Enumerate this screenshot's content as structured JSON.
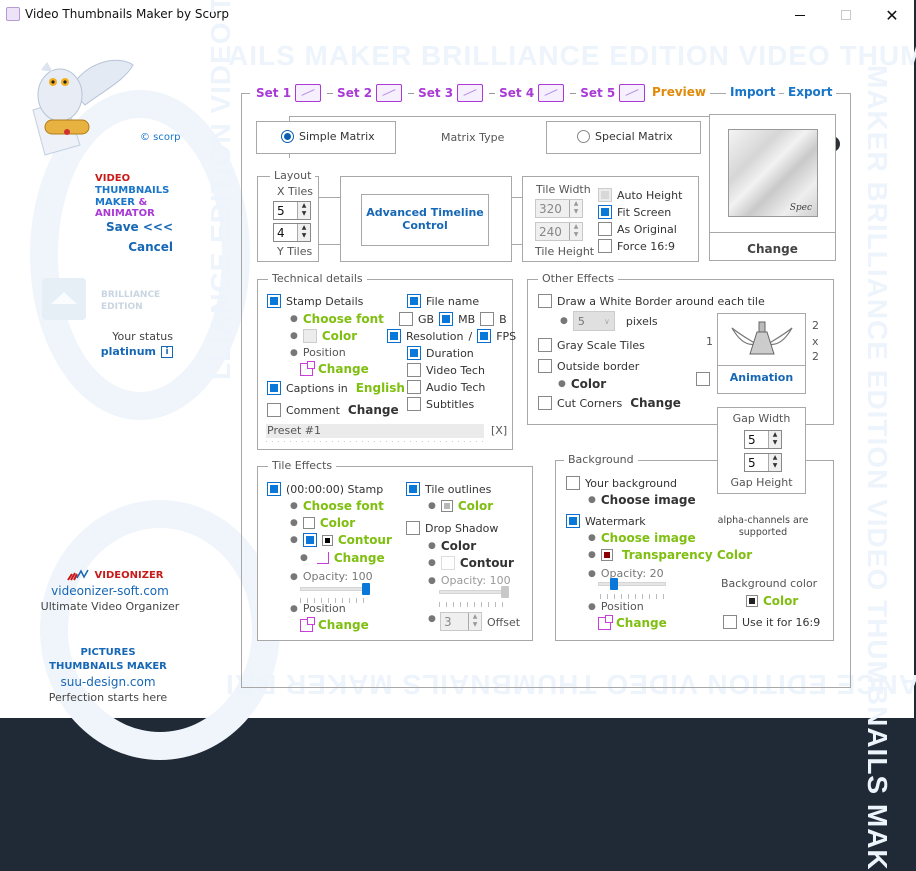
{
  "window": {
    "title": "Video Thumbnails Maker by Scorp",
    "minimize": "minimize",
    "maximize": "maximize",
    "close": "✕"
  },
  "watermark": {
    "top": "AILS MAKER BRILLIANCE EDITION VIDEO THUMBNAILS M",
    "bottom": "ER BRILLIANCE EDITION VIDEO THUMBNAILS MAKER BRI",
    "left": "LLIANCE EDITION VIDEO THUMBNAIL VIDEO THUMBN",
    "right": "MAKER BRILLIANCE EDITION VIDEO THUMBNAILS MAK"
  },
  "sidebar": {
    "copyright": "© scorp",
    "brand_line1": "VIDEO",
    "brand_line2": "THUMBNAILS",
    "brand_line3a": "MAKER",
    "brand_line3b": "& ANIMATOR",
    "save": "Save <<<",
    "cancel": "Cancel",
    "edition_line1": "BRILLIANCE",
    "edition_line2": "EDITION",
    "status_label": "Your status",
    "status_value": "platinum",
    "info": "i",
    "videonizer": {
      "name": "VIDEONIZER",
      "url": "videonizer-soft.com",
      "tagline": "Ultimate Video Organizer"
    },
    "pictures": {
      "line1": "PICTURES",
      "line2": "THUMBNAILS MAKER",
      "url": "suu-design.com",
      "tagline": "Perfection starts here"
    }
  },
  "nav": {
    "sets": [
      "Set 1",
      "Set 2",
      "Set 3",
      "Set 4",
      "Set 5"
    ],
    "preview": "Preview",
    "import": "Import",
    "export": "Export",
    "next": "➜"
  },
  "matrix": {
    "simple": "Simple Matrix",
    "type_label": "Matrix Type",
    "special": "Special Matrix",
    "selected": "Simple Matrix",
    "preview_caption": "Spec",
    "change": "Change"
  },
  "layout": {
    "legend": "Layout",
    "x_label": "X Tiles",
    "x_value": "5",
    "y_value": "4",
    "y_label": "Y Tiles",
    "timeline_line1": "Advanced Timeline",
    "timeline_line2": "Control",
    "tile_width_label": "Tile Width",
    "tile_width": "320",
    "tile_height": "240",
    "tile_height_label": "Tile Height",
    "options": [
      {
        "label": "Auto Height",
        "checked": false,
        "disabled": true
      },
      {
        "label": "Fit Screen",
        "checked": true
      },
      {
        "label": "As Original",
        "checked": false
      },
      {
        "label": "Force 16:9",
        "checked": false
      }
    ]
  },
  "technical": {
    "legend": "Technical  details",
    "stamp_details": "Stamp Details",
    "choose_font": "Choose font",
    "color": "Color",
    "position": "Position",
    "change": "Change",
    "captions_in": "Captions in",
    "language": "English",
    "comment": "Comment",
    "comment_change": "Change",
    "file_name": "File name",
    "gb": "GB",
    "mb": "MB",
    "b": "B",
    "resolution": "Resolution",
    "slash": "/",
    "fps": "FPS",
    "duration": "Duration",
    "video_tech": "Video Tech",
    "audio_tech": "Audio Tech",
    "subtitles": "Subtitles",
    "preset": "Preset #1",
    "preset_close": "[X]"
  },
  "other_effects": {
    "legend": "Other Effects",
    "white_border": "Draw a White Border around each tile",
    "border_px": "5",
    "pixels": "pixels",
    "gray_scale": "Gray Scale Tiles",
    "outside_border": "Outside border",
    "color": "Color",
    "cut_corners": "Cut Corners",
    "change": "Change",
    "anim_left": "1",
    "anim_right_1": "2",
    "anim_right_x": "x",
    "anim_right_2": "2",
    "animation": "Animation"
  },
  "gap": {
    "width_label": "Gap Width",
    "width": "5",
    "height": "5",
    "height_label": "Gap Height"
  },
  "tile_effects": {
    "legend": "Tile Effects",
    "stamp": "(00:00:00) Stamp",
    "choose_font": "Choose font",
    "color": "Color",
    "contour": "Contour",
    "change": "Change",
    "opacity_label": "Opacity: 100",
    "opacity": 100,
    "position": "Position",
    "position_change": "Change",
    "tile_outlines": "Tile outlines",
    "outline_color": "Color",
    "drop_shadow": "Drop Shadow",
    "shadow_color": "Color",
    "shadow_contour": "Contour",
    "shadow_opacity_label": "Opacity: 100",
    "shadow_opacity": 100,
    "offset_value": "3",
    "offset": "Offset"
  },
  "background": {
    "legend": "Background",
    "your_background": "Your background",
    "choose_image": "Choose image",
    "watermark": "Watermark",
    "wm_choose_image": "Choose image",
    "transparency_color": "Transparency Color",
    "alpha_line1": "alpha-channels are",
    "alpha_line2": "supported",
    "opacity_label": "Opacity: 20",
    "opacity": 20,
    "position": "Position",
    "change": "Change",
    "bg_color_label": "Background color",
    "bg_color": "Color",
    "use_169": "Use it for 16:9"
  },
  "colors": {
    "accent_blue": "#0a78d8",
    "link_blue": "#1667b5",
    "green": "#7fbf10",
    "purple": "#a93ad6",
    "orange": "#e08a0a",
    "transparency_swatch": "#8b0000",
    "bg_swatch": "#222222"
  }
}
